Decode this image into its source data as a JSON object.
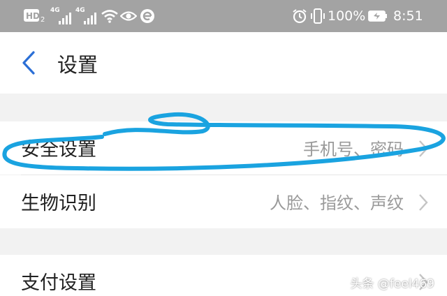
{
  "status_bar": {
    "hd_badge": "HD",
    "hd_sub": "2",
    "network_1": "4G",
    "network_2": "4G",
    "battery_percent": "100%",
    "time": "8:51",
    "icons": [
      "hd-icon",
      "signal-icon",
      "signal-icon",
      "wifi-icon",
      "eye-icon",
      "e-app-icon",
      "alarm-icon",
      "vibrate-icon",
      "battery-charging-icon"
    ],
    "background": "#a3a3a3"
  },
  "header": {
    "title": "设置",
    "back_icon": "chevron-left-icon",
    "accent": "#2b6fd6"
  },
  "rows": [
    {
      "label": "安全设置",
      "value": "手机号、密码"
    },
    {
      "label": "生物识别",
      "value": "人脸、指纹、声纹"
    },
    {
      "label": "支付设置",
      "value": ""
    }
  ],
  "annotation": {
    "color": "#1aa3e0",
    "shape": "hand-drawn ellipse around 安全设置 row"
  },
  "watermark": "头条 @feel469"
}
